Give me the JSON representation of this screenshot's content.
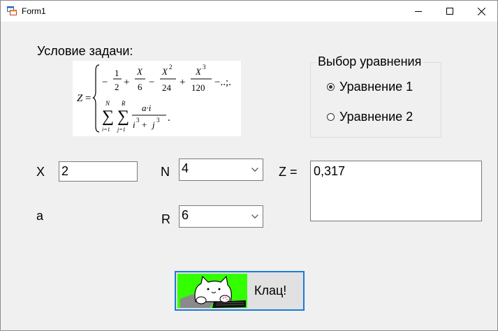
{
  "window": {
    "title": "Form1"
  },
  "icons": {
    "app": "form-app-icon",
    "minimize": "minimize-icon",
    "maximize": "maximize-icon",
    "close": "close-icon",
    "dropdown": "chevron-down-icon",
    "button_image": "bongo-cat-image"
  },
  "condition_label": "Условие задачи:",
  "formula": {
    "lhs": "Z =",
    "case1": "−1/2 + X/6 − X²/24 + X³/120 − ...;.",
    "case2": "Σ(i=1..N) Σ(j=1..R) a·i / (i³ + j³)."
  },
  "equation_group": {
    "title": "Выбор уравнения",
    "options": [
      {
        "label": "Уравнение 1",
        "checked": true
      },
      {
        "label": "Уравнение 2",
        "checked": false
      }
    ]
  },
  "inputs": {
    "x_label": "X",
    "x_value": "2",
    "a_label": "a",
    "n_label": "N",
    "n_value": "4",
    "r_label": "R",
    "r_value": "6"
  },
  "result": {
    "label": "Z =",
    "value": "0,317"
  },
  "action_button": {
    "label": "Клац!"
  },
  "colors": {
    "window_bg": "#f0f0f0",
    "button_border": "#1e7ad6",
    "button_image_bg": "#33ff00"
  }
}
